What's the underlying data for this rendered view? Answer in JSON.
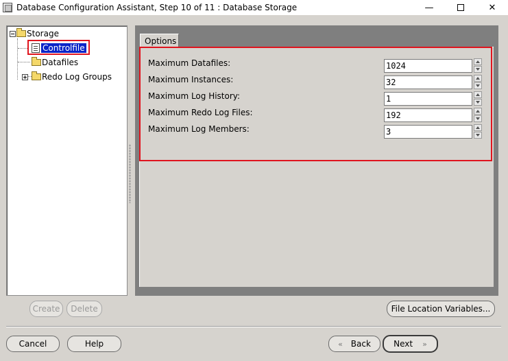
{
  "window": {
    "title": "Database Configuration Assistant, Step 10 of 11 : Database Storage",
    "min_glyph": "—",
    "close_glyph": "✕"
  },
  "tree": {
    "root": "Storage",
    "items": [
      {
        "label": "Controlfile",
        "selected": true
      },
      {
        "label": "Datafiles",
        "selected": false
      },
      {
        "label": "Redo Log Groups",
        "selected": false
      }
    ]
  },
  "tab": {
    "label": "Options"
  },
  "fields": [
    {
      "label": "Maximum Datafiles:",
      "value": "1024"
    },
    {
      "label": "Maximum Instances:",
      "value": "32"
    },
    {
      "label": "Maximum Log History:",
      "value": "1"
    },
    {
      "label": "Maximum Redo Log Files:",
      "value": "192"
    },
    {
      "label": "Maximum Log Members:",
      "value": "3"
    }
  ],
  "buttons": {
    "create": "Create",
    "delete": "Delete",
    "file_location": "File Location Variables...",
    "cancel": "Cancel",
    "help": "Help",
    "back": "Back",
    "next": "Next",
    "back_glyph": "«",
    "next_glyph": "»"
  },
  "colors": {
    "highlight": "#e0141e",
    "selection": "#0a24c8"
  }
}
